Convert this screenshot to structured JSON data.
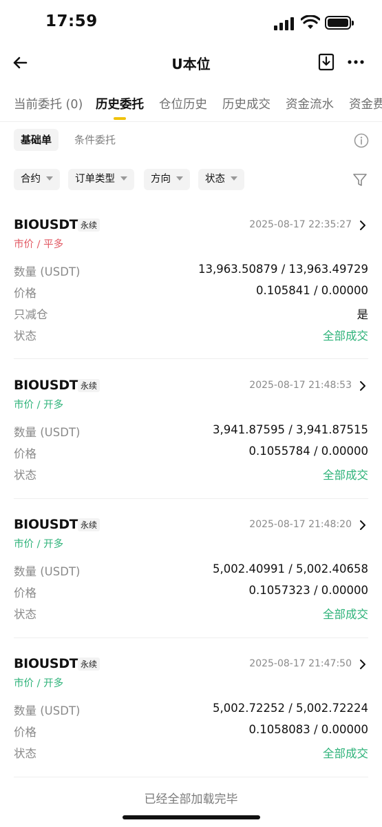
{
  "status_bar": {
    "time": "17:59"
  },
  "nav": {
    "title": "U本位",
    "back_icon": "arrow-left-icon",
    "download_icon": "download-icon",
    "more_icon": "more-icon"
  },
  "tabs": [
    {
      "label": "当前委托 (0)"
    },
    {
      "label": "历史委托"
    },
    {
      "label": "仓位历史"
    },
    {
      "label": "历史成交"
    },
    {
      "label": "资金流水"
    },
    {
      "label": "资金费"
    }
  ],
  "subtabs": {
    "basic": "基础单",
    "conditional": "条件委托"
  },
  "filters": [
    {
      "label": "合约"
    },
    {
      "label": "订单类型"
    },
    {
      "label": "方向"
    },
    {
      "label": "状态"
    }
  ],
  "labels": {
    "qty": "数量 (USDT)",
    "price": "价格",
    "reduce_only": "只减仓",
    "status": "状态"
  },
  "orders": [
    {
      "symbol": "BIOUSDT",
      "badge": "永续",
      "time": "2025-08-17 22:35:27",
      "type": "市价 / 平多",
      "qty": "13,963.50879 / 13,963.49729",
      "price": "0.105841 / 0.00000",
      "reduce_only": "是",
      "status": "全部成交"
    },
    {
      "symbol": "BIOUSDT",
      "badge": "永续",
      "time": "2025-08-17 21:48:53",
      "type": "市价 / 开多",
      "qty": "3,941.87595 / 3,941.87515",
      "price": "0.1055784 / 0.00000",
      "status": "全部成交"
    },
    {
      "symbol": "BIOUSDT",
      "badge": "永续",
      "time": "2025-08-17 21:48:20",
      "type": "市价 / 开多",
      "qty": "5,002.40991 / 5,002.40658",
      "price": "0.1057323 / 0.00000",
      "status": "全部成交"
    },
    {
      "symbol": "BIOUSDT",
      "badge": "永续",
      "time": "2025-08-17 21:47:50",
      "type": "市价 / 开多",
      "qty": "5,002.72252 / 5,002.72224",
      "price": "0.1058083 / 0.00000",
      "status": "全部成交"
    }
  ],
  "footer": "已经全部加载完毕",
  "colors": {
    "accent": "#f0c20c",
    "green": "#2fb37a",
    "red": "#e25a64"
  }
}
